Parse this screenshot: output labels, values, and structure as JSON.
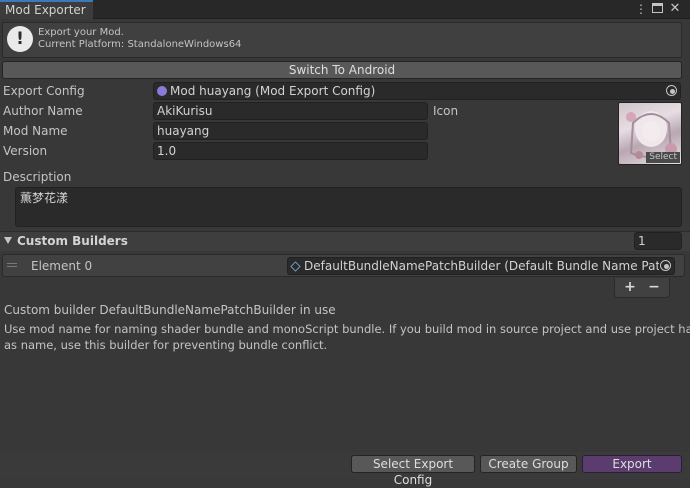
{
  "window": {
    "tab_title": "Mod Exporter",
    "menu_icon": "kebab-menu-icon",
    "maximize_icon": "maximize-icon",
    "close_icon": "close-icon"
  },
  "help": {
    "icon": "exclamation-icon",
    "line1": "Export your Mod.",
    "line2": "Current Platform: StandaloneWindows64"
  },
  "switch_button": "Switch To Android",
  "fields": {
    "export_config_label": "Export Config",
    "export_config_value": "Mod huayang (Mod Export Config)",
    "author_label": "Author Name",
    "author_value": "AkiKurisu",
    "icon_label": "Icon",
    "mod_name_label": "Mod Name",
    "mod_name_value": "huayang",
    "version_label": "Version",
    "version_value": "1.0",
    "description_label": "Description",
    "description_value": "薫梦花漾"
  },
  "icon_preview": {
    "select_label": "Select"
  },
  "builders": {
    "title": "Custom Builders",
    "count": "1",
    "element_label": "Element 0",
    "element_value": "DefaultBundleNamePatchBuilder (Default Bundle Name Patch Builder)",
    "plus": "+",
    "minus": "−"
  },
  "info": {
    "title": "Custom builder DefaultBundleNamePatchBuilder in use",
    "body_line1": "Use mod name for naming shader bundle and monoScript bundle. If you build mod in source project and use project hash",
    "body_line2": "as name, use this builder for preventing bundle conflict."
  },
  "bottom": {
    "select_config": "Select Export Config",
    "create_group": "Create Group",
    "export": "Export"
  },
  "colors": {
    "background": "#383838",
    "field": "#2a2a2a",
    "button": "#585858",
    "export_button": "#5a3c6e",
    "tab_accent": "#3a79bb"
  }
}
